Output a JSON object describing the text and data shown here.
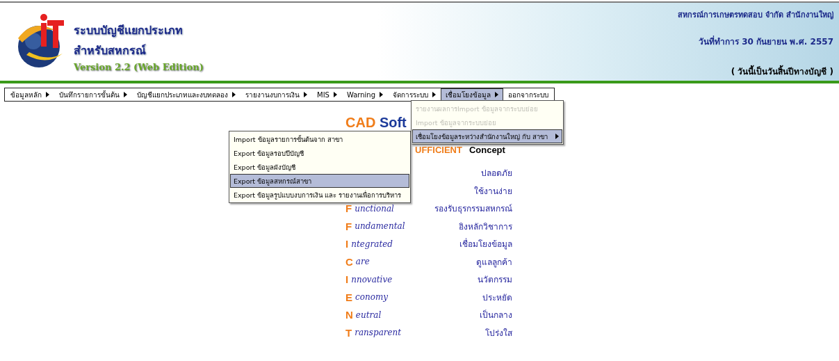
{
  "header": {
    "title_line1": "ระบบบัญชีแยกประเภท",
    "title_line2": "สำหรับสหกรณ์",
    "version": "Version 2.2 (Web Edition)",
    "company": "สหกรณ์การเกษตรทดสอบ จำกัด สำนักงานใหญ่",
    "work_date": "วันที่ทำการ 30 กันยายน พ.ศ. 2557",
    "note": "( วันนี้เป็นวันสิ้นปีทางบัญชี )"
  },
  "menu_bar": [
    {
      "label": "ข้อมูลหลัก",
      "has_submenu": true,
      "selected": false
    },
    {
      "label": "บันทึกรายการขั้นต้น",
      "has_submenu": true,
      "selected": false
    },
    {
      "label": "บัญชีแยกประเภทและงบทดลอง",
      "has_submenu": true,
      "selected": false
    },
    {
      "label": "รายงานงบการเงิน",
      "has_submenu": true,
      "selected": false
    },
    {
      "label": "MIS",
      "has_submenu": true,
      "selected": false
    },
    {
      "label": "Warning",
      "has_submenu": true,
      "selected": false
    },
    {
      "label": "จัดการระบบ",
      "has_submenu": true,
      "selected": false
    },
    {
      "label": "เชื่อมโยงข้อมูล",
      "has_submenu": true,
      "selected": true
    },
    {
      "label": "ออกจากระบบ",
      "has_submenu": false,
      "selected": false
    }
  ],
  "submenu": [
    {
      "label": "รายงานผลการImport ข้อมูลจากระบบย่อย",
      "disabled": true,
      "has_submenu": false,
      "selected": false
    },
    {
      "label": "Import ข้อมูลจากระบบย่อย",
      "disabled": true,
      "has_submenu": false,
      "selected": false
    },
    {
      "label": "เชื่อมโยงข้อมูลระหว่างสำนักงานใหญ่ กับ สาขา",
      "disabled": false,
      "has_submenu": true,
      "selected": true
    }
  ],
  "sub_submenu": [
    {
      "label": "Import ข้อมูลรายการขั้นต้นจาก สาขา",
      "selected": false
    },
    {
      "label": "Export ข้อมูลรอบปีบัญชี",
      "selected": false
    },
    {
      "label": "Export ข้อมูลผังบัญชี",
      "selected": false
    },
    {
      "label": "Export ข้อมูลสหกรณ์สาขา",
      "selected": true
    },
    {
      "label": "Export  ข้อมูลรูปแบบงบการเงิน และ รายงานเพื่อการบริหาร",
      "selected": false
    }
  ],
  "concept": {
    "brand_part1": "CAD",
    "brand_part2": "Soft",
    "subtitle": "UFFICIENT",
    "subtitle_2": "Concept",
    "rows": [
      {
        "thai": "ปลอดภัย"
      },
      {
        "thai": "ใช้งานง่าย"
      },
      {
        "letter": "F",
        "word": "unctional",
        "thai": "รองรับธุรกรรมสหกรณ์"
      },
      {
        "letter": "F",
        "word": "undamental",
        "thai": "อิงหลักวิชาการ"
      },
      {
        "letter": "I",
        "word": "ntegrated",
        "thai": "เชื่อมโยงข้อมูล"
      },
      {
        "letter": "C",
        "word": "are",
        "thai": "ดูแลลูกค้า"
      },
      {
        "letter": "I",
        "word": "nnovative",
        "thai": "นวัตกรรม"
      },
      {
        "letter": "E",
        "word": "conomy",
        "thai": "ประหยัด"
      },
      {
        "letter": "N",
        "word": "eutral",
        "thai": "เป็นกลาง"
      },
      {
        "letter": "T",
        "word": "ransparent",
        "thai": "โปร่งใส"
      }
    ]
  }
}
